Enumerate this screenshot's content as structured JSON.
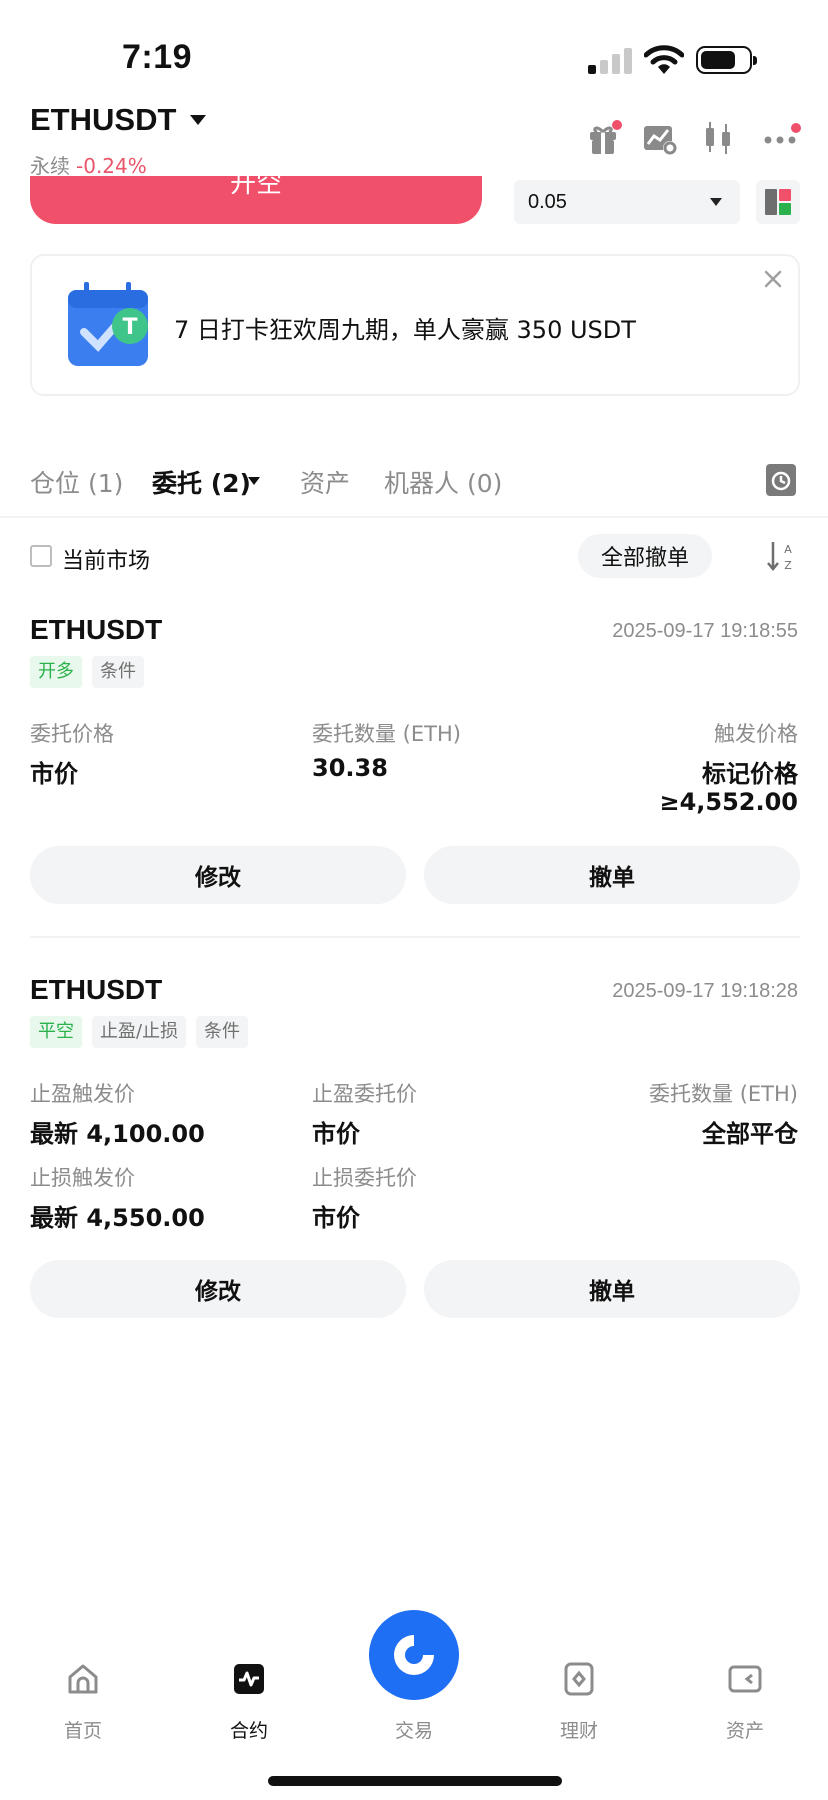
{
  "status_bar": {
    "time": "7:19"
  },
  "header": {
    "pair": "ETHUSDT",
    "type_label": "永续",
    "change": "-0.24%"
  },
  "trade": {
    "open_short_label": "开空",
    "quantity": "0.05"
  },
  "banner": {
    "text": "7 日打卡狂欢周九期，单人豪赢 350 USDT"
  },
  "tabs": [
    {
      "label": "仓位 (1)"
    },
    {
      "label": "委托 (2)"
    },
    {
      "label": "资产"
    },
    {
      "label": "机器人 (0)"
    }
  ],
  "filter": {
    "current_market_label": "当前市场",
    "cancel_all_label": "全部撤单"
  },
  "orders": [
    {
      "symbol": "ETHUSDT",
      "time": "2025-09-17 19:18:55",
      "tags": [
        "开多",
        "条件"
      ],
      "fields": {
        "order_price_label": "委托价格",
        "order_price_value": "市价",
        "qty_label": "委托数量 (ETH)",
        "qty_value": "30.38",
        "trigger_label": "触发价格",
        "trigger_value_1": "标记价格",
        "trigger_value_2": "≥4,552.00"
      },
      "modify_label": "修改",
      "cancel_label": "撤单"
    },
    {
      "symbol": "ETHUSDT",
      "time": "2025-09-17 19:18:28",
      "tags": [
        "平空",
        "止盈/止损",
        "条件"
      ],
      "fields": {
        "tp_trigger_label": "止盈触发价",
        "tp_trigger_value": "最新 4,100.00",
        "tp_order_label": "止盈委托价",
        "tp_order_value": "市价",
        "qty_label": "委托数量 (ETH)",
        "qty_value": "全部平仓",
        "sl_trigger_label": "止损触发价",
        "sl_trigger_value": "最新 4,550.00",
        "sl_order_label": "止损委托价",
        "sl_order_value": "市价"
      },
      "modify_label": "修改",
      "cancel_label": "撤单"
    }
  ],
  "bottom_nav": [
    {
      "label": "首页",
      "icon": "home-icon"
    },
    {
      "label": "合约",
      "icon": "futures-icon"
    },
    {
      "label": "交易",
      "icon": "trade-icon"
    },
    {
      "label": "理财",
      "icon": "earn-icon"
    },
    {
      "label": "资产",
      "icon": "wallet-icon"
    }
  ],
  "colors": {
    "short_red": "#f0506a",
    "long_green": "#2bb24c",
    "accent_blue": "#1e6ff4",
    "negative_change": "#e8566a"
  }
}
